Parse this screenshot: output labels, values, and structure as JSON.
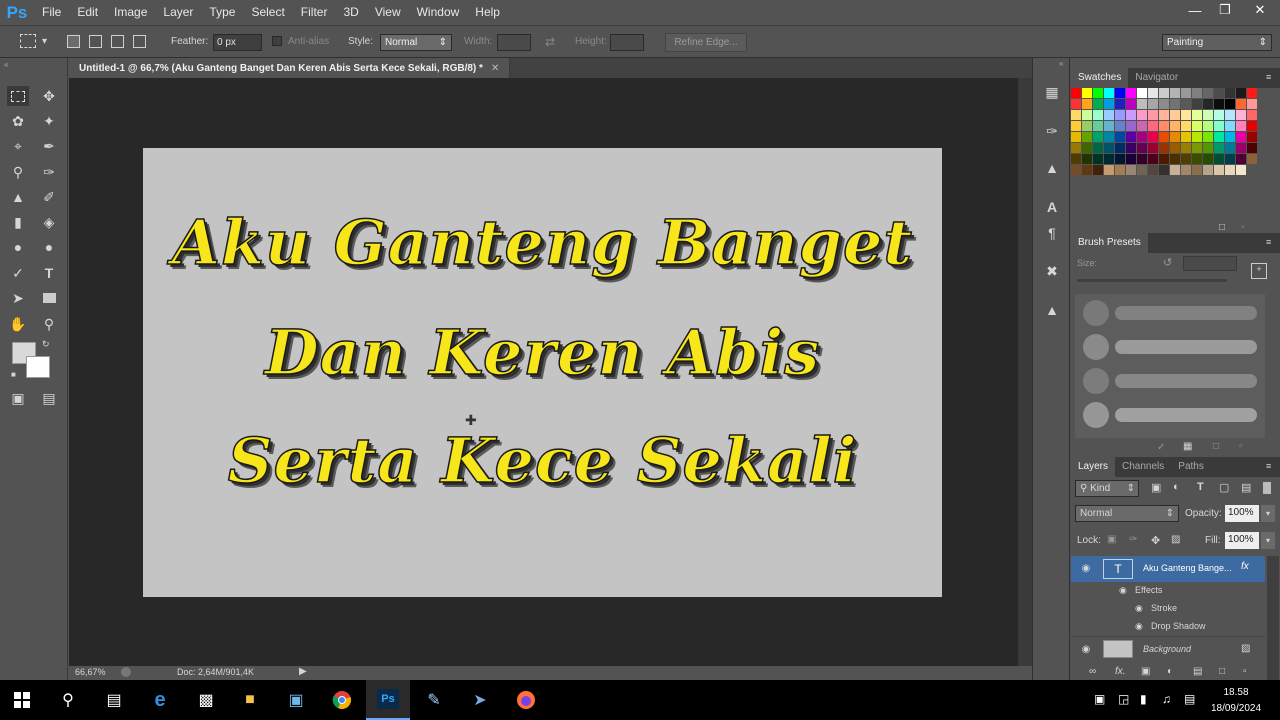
{
  "app": {
    "logo": "Ps",
    "menu": [
      "File",
      "Edit",
      "Image",
      "Layer",
      "Type",
      "Select",
      "Filter",
      "3D",
      "View",
      "Window",
      "Help"
    ]
  },
  "options": {
    "feather_label": "Feather:",
    "feather_value": "0 px",
    "antialias_label": "Anti-alias",
    "style_label": "Style:",
    "style_value": "Normal",
    "width_label": "Width:",
    "height_label": "Height:",
    "refine_edge": "Refine Edge...",
    "workspace": "Painting"
  },
  "document": {
    "tab_title": "Untitled-1 @ 66,7% (Aku Ganteng Banget Dan Keren Abis Serta Kece Sekali, RGB/8) *",
    "text_lines": [
      "Aku Ganteng Banget",
      "Dan Keren Abis",
      "Serta Kece Sekali"
    ],
    "zoom": "66,67%",
    "doc_info": "Doc: 2,64M/901,4K",
    "text_color": "#f7e619",
    "canvas_color": "#c4c4c4"
  },
  "panels": {
    "swatches_tab": "Swatches",
    "navigator_tab": "Navigator",
    "brush_presets_tab": "Brush Presets",
    "size_label": "Size:",
    "layers_tab": "Layers",
    "channels_tab": "Channels",
    "paths_tab": "Paths",
    "kind_label": "Kind",
    "blend_mode": "Normal",
    "opacity_label": "Opacity:",
    "opacity_value": "100%",
    "lock_label": "Lock:",
    "fill_label": "Fill:",
    "fill_value": "100%",
    "layers": {
      "text_layer_name": "Aku Ganteng Bange...",
      "fx_label": "fx",
      "effects_label": "Effects",
      "stroke_label": "Stroke",
      "drop_shadow_label": "Drop Shadow",
      "background_name": "Background"
    }
  },
  "taskbar": {
    "time": "18.58",
    "date": "18/09/2024"
  },
  "swatch_colors": [
    "#ff0000",
    "#ffff00",
    "#00ff00",
    "#00ffff",
    "#0000ff",
    "#ff00ff",
    "#ffffff",
    "#e6e6e6",
    "#cccccc",
    "#b3b3b3",
    "#999999",
    "#808080",
    "#666666",
    "#4d4d4d",
    "#333333",
    "#1a1a1a",
    "#ff1a1a",
    "#ff3333",
    "#ffa31a",
    "#00b050",
    "#00a0e0",
    "#2020c0",
    "#c000c0",
    "#bdbdbd",
    "#a6a6a6",
    "#8c8c8c",
    "#737373",
    "#595959",
    "#404040",
    "#262626",
    "#0d0d0d",
    "#000000",
    "#ff6633",
    "#ff9999",
    "#ffd966",
    "#ccff99",
    "#99ffcc",
    "#99ccff",
    "#9999ff",
    "#cc99ff",
    "#ff99cc",
    "#ff99a6",
    "#ffb399",
    "#ffcc99",
    "#ffe699",
    "#e6ff99",
    "#ccffb3",
    "#b3ffe6",
    "#b3e6ff",
    "#ffb3d9",
    "#ff6666",
    "#ffcc33",
    "#99cc66",
    "#66cc99",
    "#66b3cc",
    "#6680cc",
    "#9966cc",
    "#cc66b3",
    "#ff6680",
    "#ff8c66",
    "#ffb366",
    "#ffd966",
    "#d9ff66",
    "#b3ff80",
    "#80ffcc",
    "#80d9ff",
    "#ff80bf",
    "#e60000",
    "#e6b800",
    "#66a300",
    "#00a36b",
    "#0085a3",
    "#0047a3",
    "#5c00a3",
    "#a30085",
    "#e6004d",
    "#e64d00",
    "#e68a00",
    "#e6c200",
    "#b8e600",
    "#7ae600",
    "#00e6a3",
    "#00b8e6",
    "#e600a3",
    "#990000",
    "#997a00",
    "#406600",
    "#006644",
    "#005266",
    "#002c66",
    "#3a0066",
    "#660052",
    "#990033",
    "#993300",
    "#995c00",
    "#998000",
    "#7a9900",
    "#529900",
    "#00996b",
    "#007a99",
    "#99006b",
    "#4d0000",
    "#4d3d00",
    "#203300",
    "#003322",
    "#002933",
    "#001633",
    "#1d0033",
    "#330029",
    "#4d001a",
    "#4d1a00",
    "#4d2e00",
    "#4d4000",
    "#3d4d00",
    "#294d00",
    "#004d36",
    "#003d4d",
    "#4d0036",
    "#8c6239",
    "#754c24",
    "#603913",
    "#42210b",
    "#c69c6d",
    "#a67c52",
    "#998675",
    "#736357",
    "#534741",
    "#362f2d",
    "#c7b299",
    "#a3876a",
    "#8a6e4b",
    "#b5a48c",
    "#d9c7a7",
    "#e8d7b8",
    "#f2e6cf"
  ]
}
